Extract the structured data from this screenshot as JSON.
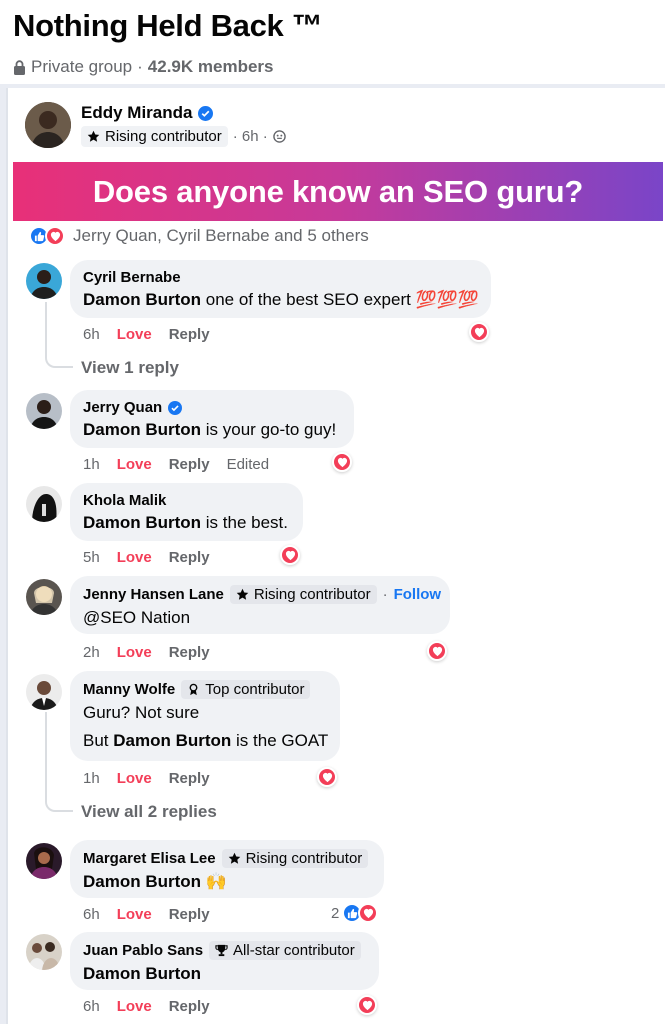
{
  "group": {
    "title": "Nothing Held Back ™",
    "privacy": "Private group",
    "separator": "·",
    "members": "42.9K members"
  },
  "post": {
    "author": "Eddy Miranda",
    "author_badge": "Rising contributor",
    "time": "· 6h ·",
    "banner_text": "Does anyone know an SEO guru?",
    "reactions_text": "Jerry Quan, Cyril Bernabe and 5 others"
  },
  "comments": [
    {
      "name": "Cyril Bernabe",
      "mention": "Damon Burton",
      "text": " one of the best SEO expert 💯💯💯",
      "time": "6h",
      "love": "Love",
      "reply": "Reply",
      "view_replies": "View 1 reply"
    },
    {
      "name": "Jerry Quan",
      "mention": "Damon Burton",
      "text": " is your go-to guy!",
      "time": "1h",
      "love": "Love",
      "reply": "Reply",
      "edited": "Edited"
    },
    {
      "name": "Khola Malik",
      "mention": "Damon Burton",
      "text": " is the best.",
      "time": "5h",
      "love": "Love",
      "reply": "Reply"
    },
    {
      "name": "Jenny Hansen Lane",
      "badge": "Rising contributor",
      "follow_sep": "·",
      "follow": "Follow",
      "text": "@SEO Nation",
      "time": "2h",
      "love": "Love",
      "reply": "Reply"
    },
    {
      "name": "Manny Wolfe",
      "badge": "Top contributor",
      "text": "Guru? Not sure",
      "text2_pre": "But ",
      "mention": "Damon Burton",
      "text2_post": " is the GOAT",
      "time": "1h",
      "love": "Love",
      "reply": "Reply",
      "view_replies": "View all 2 replies"
    },
    {
      "name": "Margaret Elisa Lee",
      "badge": "Rising contributor",
      "mention": "Damon Burton",
      "text": " 🙌",
      "time": "6h",
      "love": "Love",
      "reply": "Reply",
      "reaction_count": "2"
    },
    {
      "name": "Juan Pablo Sans",
      "badge": "All-star contributor",
      "mention": "Damon Burton",
      "time": "6h",
      "love": "Love",
      "reply": "Reply"
    }
  ],
  "colors": {
    "accent": "#1877f2",
    "love": "#f33e58",
    "banner_start": "#e83078",
    "banner_end": "#7a45c8"
  }
}
